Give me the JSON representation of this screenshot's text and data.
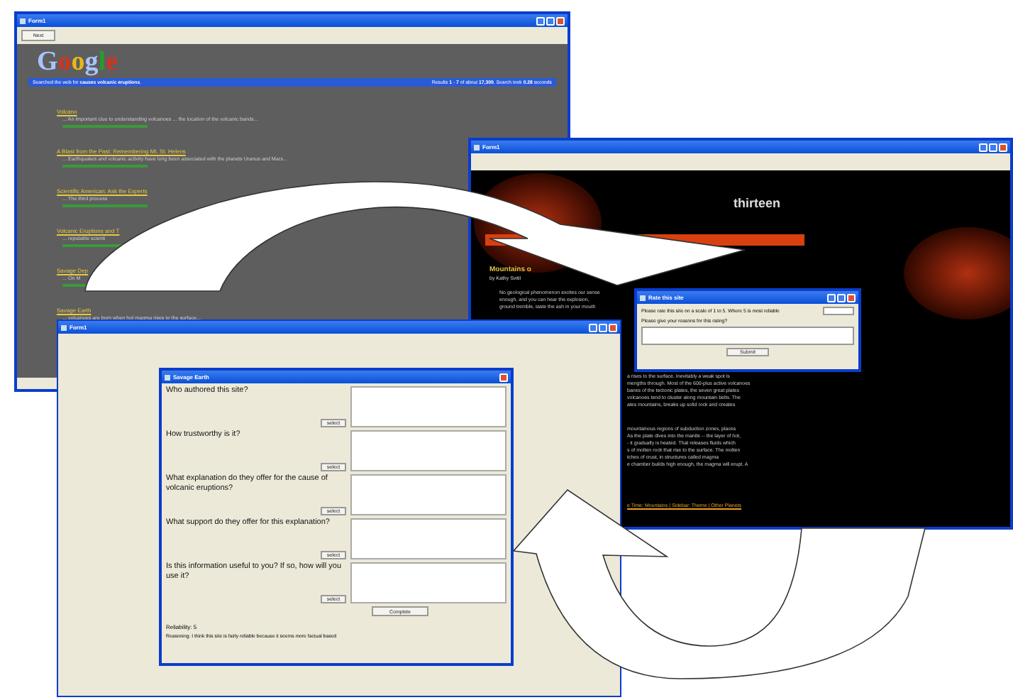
{
  "windows": [
    {
      "kind": "search",
      "title": "Form1",
      "button": "Next",
      "logo": "Google",
      "summary": "Searched the web for **causes volcanic eruptions**.",
      "stats": "Results **1** - **7** of about **17,300**. Search took **0.28** seconds",
      "results": [
        {
          "title": "Volcano",
          "snippet": "... An important clue to understanding volcanoes ... the location of the volcanic bands..."
        },
        {
          "title": "A Blast from the Past: Remembering Mt. St. Helens",
          "snippet": "... Earthquakes and volcanic activity have long been associated with the planets Uranus and Mars..."
        },
        {
          "title": "Scientific American: Ask the Experts",
          "snippet": "... The third process"
        },
        {
          "title": "Volcanic Eruptions and T",
          "snippet": "... reputable scienti"
        },
        {
          "title": "Savage Dep",
          "snippet": "... On M"
        },
        {
          "title": "Savage Earth",
          "snippet": "... volcanoes are born when hot magma rises to the surface..."
        }
      ]
    },
    {
      "kind": "article",
      "title": "Form1",
      "logo": "thirteen",
      "heading": "Mountains o",
      "byline": "by Kathy Svitil",
      "paragraphs": [
        "No geological phenomenon excites our sense",
        "enough, and you can hear the explosion,",
        "ground tremble, taste the ash in your mouth"
      ],
      "column": [
        "a rises to the surface. Inevitably a weak spot is",
        "mengths through. Most of the 600-plus active volcanoes",
        "banes of the tectonic plates, the seven great plates",
        "volcanoes tend to cluster along mountain belts. The",
        "ates mountains, breaks up solid rock and creates"
      ],
      "column2": [
        "mountainous regions of subduction zones, places",
        "As the plate dives into the mantle -- the layer of hot,",
        "- it gradually is heated. That releases fluids which",
        "s of molten rock that rise to the surface. The molten",
        "tches of crust, in structures called magma",
        "e chamber builds high enough, the magma will erupt. A"
      ],
      "footer": "e Time: Mountains | Sidebar: Theme | Other Planets",
      "dialog": {
        "title": "Rate this site",
        "prompt": "Please rate this site on a scale of 1 to 5.  Where 5 is most reliable",
        "reason_prompt": "Please give your reasons for this rating?",
        "button": "Submit"
      }
    },
    {
      "kind": "questionnaire",
      "title": "Form1",
      "dialog": {
        "title": "Savage Earth",
        "questions": [
          {
            "text": "Who authored this site?",
            "button": "select"
          },
          {
            "text": "How trustworthy is it?",
            "button": "select"
          },
          {
            "text": "What explanation do they offer for the cause of volcanic eruptions?",
            "button": "select"
          },
          {
            "text": "What support do they offer for this explanation?",
            "button": "select"
          },
          {
            "text": "Is this information useful to you? If so, how will you use it?",
            "button": "select"
          }
        ],
        "button": "Complete",
        "reliability": "Reliability: 5",
        "reasoning": "Reasoning: I think this site is fairly reliable because it seems more factual based"
      }
    }
  ]
}
